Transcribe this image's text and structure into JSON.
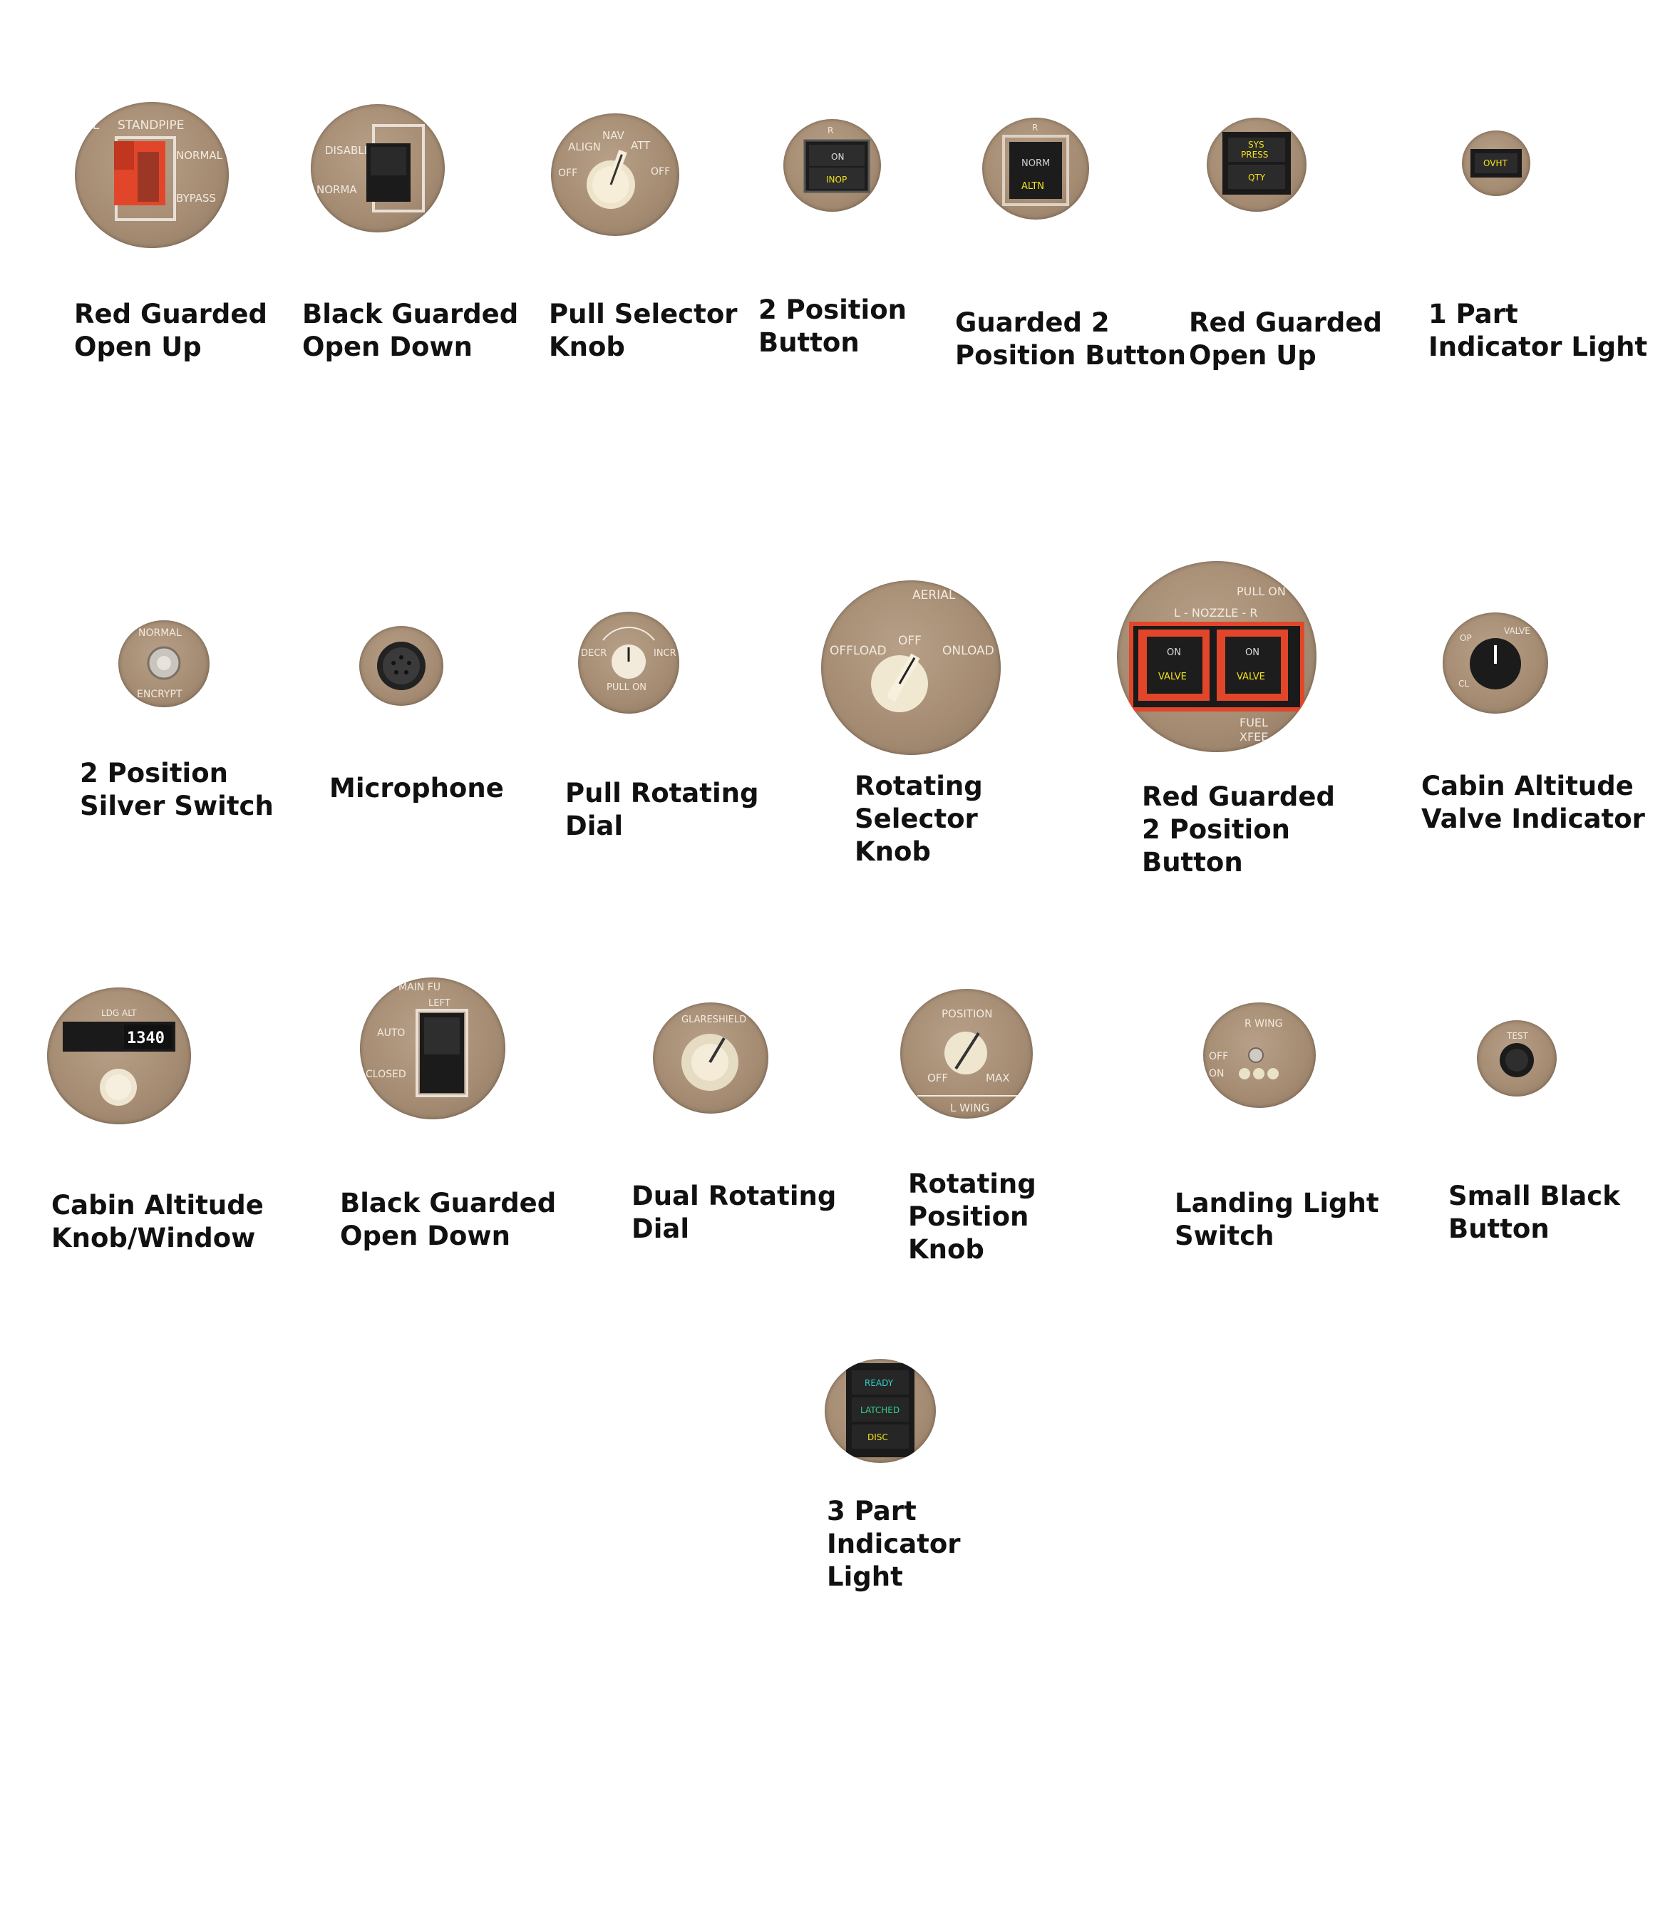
{
  "items": [
    {
      "label": [
        "Red Guarded",
        "Open Up"
      ]
    },
    {
      "label": [
        "Black Guarded",
        "Open Down"
      ]
    },
    {
      "label": [
        "Pull Selector",
        "Knob"
      ]
    },
    {
      "label": [
        "2 Position",
        "Button"
      ]
    },
    {
      "label": [
        "Guarded 2",
        "Position Button"
      ]
    },
    {
      "label": [
        "Red Guarded",
        "Open Up"
      ]
    },
    {
      "label": [
        "1 Part",
        "Indicator Light"
      ]
    },
    {
      "label": [
        "2 Position",
        "Silver Switch"
      ]
    },
    {
      "label": [
        "Microphone"
      ]
    },
    {
      "label": [
        "Pull Rotating",
        "Dial"
      ]
    },
    {
      "label": [
        "Rotating",
        "Selector",
        "Knob"
      ]
    },
    {
      "label": [
        "Red Guarded",
        "2 Position",
        "Button"
      ]
    },
    {
      "label": [
        "Cabin Altitude",
        "Valve Indicator"
      ]
    },
    {
      "label": [
        "Cabin Altitude",
        "Knob/Window"
      ]
    },
    {
      "label": [
        "Black Guarded",
        "Open Down"
      ]
    },
    {
      "label": [
        "Dual Rotating",
        "Dial"
      ]
    },
    {
      "label": [
        "Rotating",
        "Position",
        "Knob"
      ]
    },
    {
      "label": [
        "Landing Light",
        "Switch"
      ]
    },
    {
      "label": [
        "Small Black",
        "Button"
      ]
    },
    {
      "label": [
        "3 Part",
        "Indicator",
        "Light"
      ]
    }
  ],
  "panel_text": {
    "i0": [
      "EL",
      "STANDPIPE",
      "NORMAL",
      "BYPASS"
    ],
    "i1": [
      "DISABLE",
      "NORMA"
    ],
    "i2": [
      "NAV",
      "ALIGN",
      "ATT",
      "OFF",
      "OFF"
    ],
    "i3": [
      "R",
      "ON",
      "INOP"
    ],
    "i4": [
      "R",
      "NORM",
      "ALTN"
    ],
    "i5": [
      "SYS",
      "PRESS",
      "QTY"
    ],
    "i6": [
      "OVHT"
    ],
    "i7": [
      "NORMAL",
      "ENCRYPT"
    ],
    "i9": [
      "DECR",
      "INCR",
      "PULL ON"
    ],
    "i10": [
      "AERIAL",
      "OFF",
      "OFFLOAD",
      "ONLOAD"
    ],
    "i11": [
      "PULL ON",
      "L - NOZZLE - R",
      "ON",
      "VALVE",
      "ON",
      "VALVE",
      "FUEL",
      "XFEE"
    ],
    "i12": [
      "OP",
      "VALVE",
      "CL"
    ],
    "i13": [
      "LDG ALT",
      "1340"
    ],
    "i14": [
      "MAIN FU",
      "LEFT",
      "AUTO",
      "CLOSED"
    ],
    "i15": [
      "GLARESHIELD"
    ],
    "i16": [
      "POSITION",
      "OFF",
      "MAX",
      "L WING"
    ],
    "i17": [
      "R WING",
      "OFF",
      "ON"
    ],
    "i18": [
      "TEST"
    ],
    "i19": [
      "READY",
      "LATCHED",
      "DISC"
    ]
  },
  "colors": {
    "panel": "#a48b72",
    "guard_red": "#e2462a",
    "legend_yellow": "#f2e21c",
    "legend_green": "#2fd38a"
  }
}
